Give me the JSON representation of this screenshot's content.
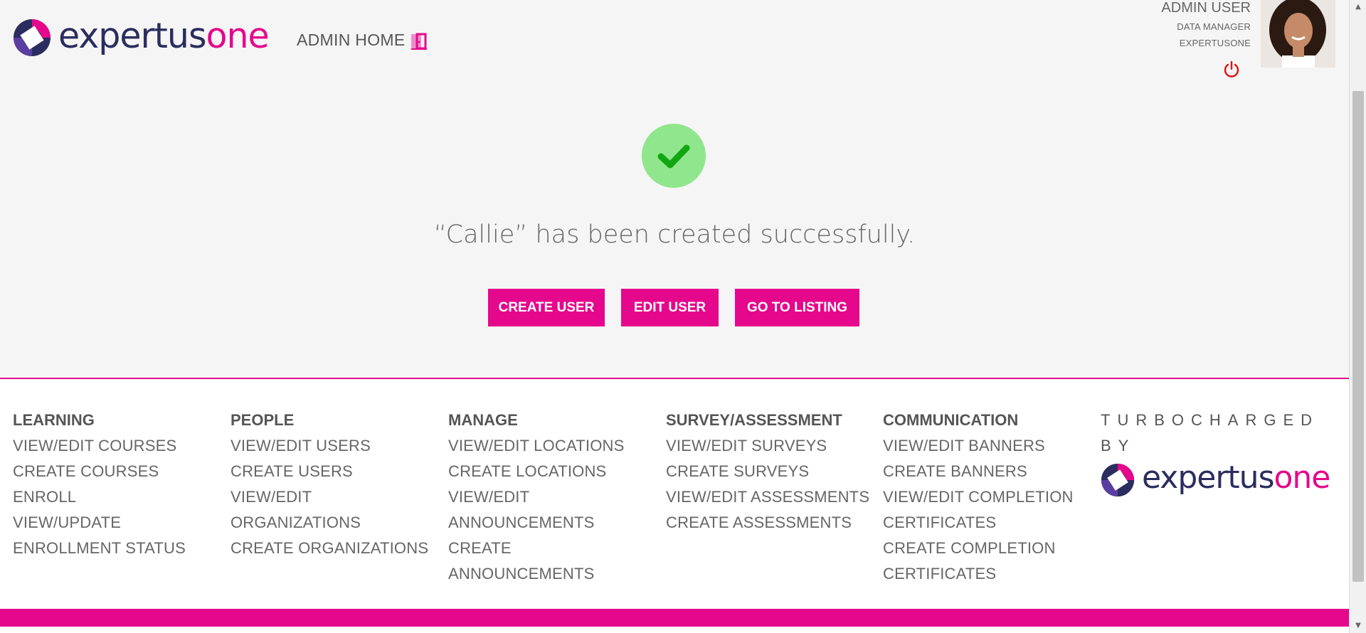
{
  "header": {
    "logo_text_a": "expertus",
    "logo_text_b": "one",
    "admin_home": "ADMIN HOME",
    "user_name": "ADMIN USER",
    "user_role": "DATA MANAGER",
    "user_org": "EXPERTUSONE"
  },
  "main": {
    "message": "“Callie” has been created successfully.",
    "buttons": {
      "create_user": "CREATE USER",
      "edit_user": "EDIT USER",
      "go_to_listing": "GO TO LISTING"
    }
  },
  "footer": {
    "columns": [
      {
        "title": "LEARNING",
        "links": [
          "VIEW/EDIT COURSES",
          "CREATE COURSES",
          "ENROLL",
          "VIEW/UPDATE",
          "ENROLLMENT STATUS"
        ]
      },
      {
        "title": "PEOPLE",
        "links": [
          "VIEW/EDIT USERS",
          "CREATE USERS",
          "VIEW/EDIT",
          "ORGANIZATIONS",
          "CREATE ORGANIZATIONS"
        ]
      },
      {
        "title": "MANAGE",
        "links": [
          "VIEW/EDIT LOCATIONS",
          "CREATE LOCATIONS",
          "VIEW/EDIT",
          "ANNOUNCEMENTS",
          "CREATE ANNOUNCEMENTS"
        ]
      },
      {
        "title": "SURVEY/ASSESSMENT",
        "links": [
          "VIEW/EDIT SURVEYS",
          "CREATE SURVEYS",
          "VIEW/EDIT ASSESSMENTS",
          "CREATE ASSESSMENTS"
        ]
      },
      {
        "title": "COMMUNICATION",
        "links": [
          "VIEW/EDIT BANNERS",
          "CREATE BANNERS",
          "VIEW/EDIT COMPLETION",
          "CERTIFICATES",
          "CREATE COMPLETION",
          "CERTIFICATES"
        ]
      }
    ],
    "turbo_line1": "TURBOCHARGED",
    "turbo_line2": "BY",
    "logo_text_a": "expertus",
    "logo_text_b": "one"
  },
  "colors": {
    "brand_pink": "#e5078c",
    "brand_navy": "#2b2d5f",
    "success_green": "#90e68c",
    "check_green": "#12a712"
  },
  "icons": [
    "logo-mark-icon",
    "door-icon",
    "power-icon",
    "check-icon"
  ]
}
